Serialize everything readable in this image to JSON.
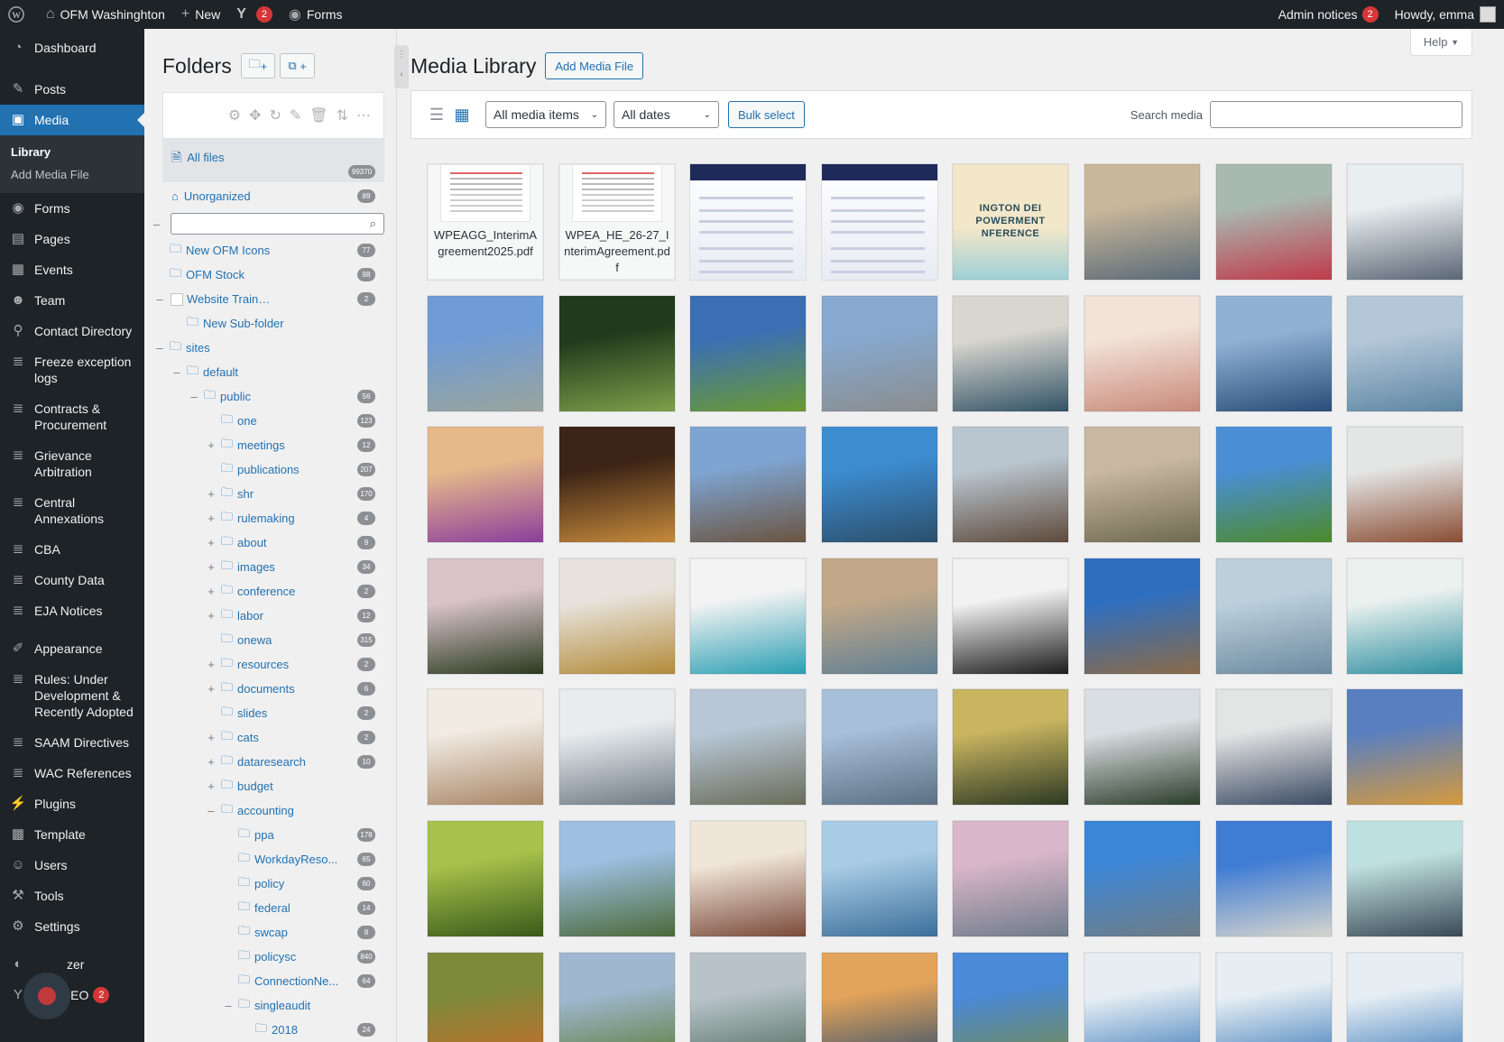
{
  "adminbar": {
    "site_name": "OFM Washinghton",
    "new_label": "New",
    "yoast_count": "2",
    "forms_label": "Forms",
    "admin_notices_label": "Admin notices",
    "admin_notices_count": "2",
    "howdy": "Howdy, emma"
  },
  "menu": {
    "dashboard": "Dashboard",
    "posts": "Posts",
    "media": "Media",
    "media_sub": {
      "library": "Library",
      "add": "Add Media File"
    },
    "forms": "Forms",
    "pages": "Pages",
    "events": "Events",
    "team": "Team",
    "contact": "Contact Directory",
    "freeze": "Freeze exception logs",
    "contracts": "Contracts & Procurement",
    "grievance": "Grievance Arbitration",
    "central": "Central Annexations",
    "cba": "CBA",
    "county": "County Data",
    "eja": "EJA Notices",
    "appearance": "Appearance",
    "rules": "Rules: Under Development & Recently Adopted",
    "saam": "SAAM Directives",
    "wac": "WAC References",
    "plugins": "Plugins",
    "template": "Template",
    "users": "Users",
    "tools": "Tools",
    "settings": "Settings",
    "item_partial_1": "zer",
    "item_partial_2": "st SEO",
    "seo_count": "2"
  },
  "folders": {
    "title": "Folders",
    "new_folder_btn": "+",
    "new_sub_btn": "+",
    "all_files": "All files",
    "all_files_count": "99370",
    "unorganized": "Unorganized",
    "unorganized_count": "89",
    "tree": [
      {
        "label": "New OFM Icons",
        "count": "77",
        "depth": 0,
        "toggle": ""
      },
      {
        "label": "OFM Stock",
        "count": "98",
        "depth": 0,
        "toggle": ""
      },
      {
        "label": "Website Training",
        "count": "2",
        "depth": 0,
        "toggle": "–",
        "checkbox": true
      },
      {
        "label": "New Sub-folder",
        "count": "",
        "depth": 1,
        "toggle": ""
      },
      {
        "label": "sites",
        "count": "",
        "depth": 0,
        "toggle": "–"
      },
      {
        "label": "default",
        "count": "",
        "depth": 1,
        "toggle": "–"
      },
      {
        "label": "public",
        "count": "56",
        "depth": 2,
        "toggle": "–"
      },
      {
        "label": "one",
        "count": "123",
        "depth": 3,
        "toggle": ""
      },
      {
        "label": "meetings",
        "count": "12",
        "depth": 3,
        "toggle": "+"
      },
      {
        "label": "publications",
        "count": "207",
        "depth": 3,
        "toggle": ""
      },
      {
        "label": "shr",
        "count": "170",
        "depth": 3,
        "toggle": "+"
      },
      {
        "label": "rulemaking",
        "count": "4",
        "depth": 3,
        "toggle": "+"
      },
      {
        "label": "about",
        "count": "9",
        "depth": 3,
        "toggle": "+"
      },
      {
        "label": "images",
        "count": "34",
        "depth": 3,
        "toggle": "+"
      },
      {
        "label": "conference",
        "count": "2",
        "depth": 3,
        "toggle": "+"
      },
      {
        "label": "labor",
        "count": "12",
        "depth": 3,
        "toggle": "+"
      },
      {
        "label": "onewa",
        "count": "315",
        "depth": 3,
        "toggle": ""
      },
      {
        "label": "resources",
        "count": "2",
        "depth": 3,
        "toggle": "+"
      },
      {
        "label": "documents",
        "count": "6",
        "depth": 3,
        "toggle": "+"
      },
      {
        "label": "slides",
        "count": "2",
        "depth": 3,
        "toggle": ""
      },
      {
        "label": "cats",
        "count": "2",
        "depth": 3,
        "toggle": "+"
      },
      {
        "label": "dataresearch",
        "count": "10",
        "depth": 3,
        "toggle": "+"
      },
      {
        "label": "budget",
        "count": "",
        "depth": 3,
        "toggle": "+"
      },
      {
        "label": "accounting",
        "count": "",
        "depth": 3,
        "toggle": "–"
      },
      {
        "label": "ppa",
        "count": "178",
        "depth": 4,
        "toggle": ""
      },
      {
        "label": "WorkdayReso...",
        "count": "65",
        "depth": 4,
        "toggle": ""
      },
      {
        "label": "policy",
        "count": "60",
        "depth": 4,
        "toggle": ""
      },
      {
        "label": "federal",
        "count": "14",
        "depth": 4,
        "toggle": ""
      },
      {
        "label": "swcap",
        "count": "8",
        "depth": 4,
        "toggle": ""
      },
      {
        "label": "policysc",
        "count": "840",
        "depth": 4,
        "toggle": ""
      },
      {
        "label": "ConnectionNe...",
        "count": "64",
        "depth": 4,
        "toggle": ""
      },
      {
        "label": "singleaudit",
        "count": "",
        "depth": 4,
        "toggle": "–"
      },
      {
        "label": "2018",
        "count": "24",
        "depth": 5,
        "toggle": ""
      }
    ]
  },
  "main": {
    "title": "Media Library",
    "add_button": "Add Media File",
    "help": "Help",
    "filter_type": "All media items",
    "filter_date": "All dates",
    "bulk_select": "Bulk select",
    "search_label": "Search media",
    "search_value": ""
  },
  "media": [
    {
      "kind": "doc",
      "name": "WPEAGG_InterimAgreement2025.pdf"
    },
    {
      "kind": "doc",
      "name": "WPEA_HE_26-27_InterimAgreement.pdf"
    },
    {
      "kind": "shot",
      "colors": [
        "#ffffff",
        "#e8ebf3"
      ]
    },
    {
      "kind": "shot",
      "colors": [
        "#ffffff",
        "#e8ebf3"
      ]
    },
    {
      "kind": "banner",
      "text": "INGTON DEI\nPOWERMENT\nNFERENCE",
      "colors": [
        "#f3e7c9",
        "#9fd0d6"
      ]
    },
    {
      "kind": "photo",
      "colors": [
        "#c9b79a",
        "#5a6b78"
      ]
    },
    {
      "kind": "photo",
      "colors": [
        "#a8b9b0",
        "#c03a4a"
      ]
    },
    {
      "kind": "photo",
      "colors": [
        "#e9eef0",
        "#5b6775"
      ]
    },
    {
      "kind": "photo",
      "colors": [
        "#6f9bd6",
        "#9aa59c"
      ]
    },
    {
      "kind": "photo",
      "colors": [
        "#1f3b1c",
        "#7da04a"
      ]
    },
    {
      "kind": "photo",
      "colors": [
        "#3b6fb4",
        "#6a9a32"
      ]
    },
    {
      "kind": "photo",
      "colors": [
        "#87a9cf",
        "#8a8d8f"
      ]
    },
    {
      "kind": "photo",
      "colors": [
        "#d9d6cf",
        "#325366"
      ]
    },
    {
      "kind": "photo",
      "colors": [
        "#f2e2d8",
        "#c98a7a"
      ]
    },
    {
      "kind": "photo",
      "colors": [
        "#8fb2d4",
        "#2a4d7a"
      ]
    },
    {
      "kind": "photo",
      "colors": [
        "#b4c7d8",
        "#5d86a3"
      ]
    },
    {
      "kind": "photo",
      "colors": [
        "#e7b98a",
        "#8a3f9c"
      ]
    },
    {
      "kind": "photo",
      "colors": [
        "#3c2416",
        "#c68a3c"
      ]
    },
    {
      "kind": "photo",
      "colors": [
        "#7ea4d2",
        "#6b5440"
      ]
    },
    {
      "kind": "photo",
      "colors": [
        "#3d8cd0",
        "#2b4f6b"
      ]
    },
    {
      "kind": "photo",
      "colors": [
        "#b9c5cf",
        "#5e4a3b"
      ]
    },
    {
      "kind": "photo",
      "colors": [
        "#c8b8a2",
        "#6f6a4f"
      ]
    },
    {
      "kind": "photo",
      "colors": [
        "#4a8fd6",
        "#4c8a2a"
      ]
    },
    {
      "kind": "photo",
      "colors": [
        "#e4e6e6",
        "#8a4d33"
      ]
    },
    {
      "kind": "photo",
      "colors": [
        "#d8c3c8",
        "#2a3a1f"
      ]
    },
    {
      "kind": "photo",
      "colors": [
        "#e7e3dc",
        "#b38b3a"
      ]
    },
    {
      "kind": "photo",
      "colors": [
        "#f3f3f3",
        "#2b9fb3"
      ]
    },
    {
      "kind": "photo",
      "colors": [
        "#c2a888",
        "#5f7f93"
      ]
    },
    {
      "kind": "photo",
      "colors": [
        "#f2f2f2",
        "#1b1b1b"
      ]
    },
    {
      "kind": "photo",
      "colors": [
        "#2f6fc0",
        "#8a6a48"
      ]
    },
    {
      "kind": "photo",
      "colors": [
        "#bcd0dc",
        "#6c8aa0"
      ]
    },
    {
      "kind": "photo",
      "colors": [
        "#eaf1ee",
        "#2f8fa0"
      ]
    },
    {
      "kind": "photo",
      "colors": [
        "#f1ebe3",
        "#a98766"
      ]
    },
    {
      "kind": "photo",
      "colors": [
        "#e8ecef",
        "#6e7a84"
      ]
    },
    {
      "kind": "photo",
      "colors": [
        "#b7c7d6",
        "#6a6d5a"
      ]
    },
    {
      "kind": "photo",
      "colors": [
        "#a7bfd9",
        "#5c7083"
      ]
    },
    {
      "kind": "photo",
      "colors": [
        "#c9b560",
        "#2e3a24"
      ]
    },
    {
      "kind": "photo",
      "colors": [
        "#d8dee2",
        "#2c3d2a"
      ]
    },
    {
      "kind": "photo",
      "colors": [
        "#e3e4e4",
        "#3b4b63"
      ]
    },
    {
      "kind": "photo",
      "colors": [
        "#5a7fc0",
        "#d49a3e"
      ]
    },
    {
      "kind": "photo",
      "colors": [
        "#a7c24a",
        "#3a5a1a"
      ]
    },
    {
      "kind": "photo",
      "colors": [
        "#9dbfe0",
        "#4b6a3a"
      ]
    },
    {
      "kind": "photo",
      "colors": [
        "#f0e6d8",
        "#7a4a3a"
      ]
    },
    {
      "kind": "photo",
      "colors": [
        "#a9cce6",
        "#3b6f9a"
      ]
    },
    {
      "kind": "photo",
      "colors": [
        "#d9b6c9",
        "#6f7c8a"
      ]
    },
    {
      "kind": "photo",
      "colors": [
        "#3d86d6",
        "#6e7d86"
      ]
    },
    {
      "kind": "photo",
      "colors": [
        "#3f7cd4",
        "#d7d5ce"
      ]
    },
    {
      "kind": "photo",
      "colors": [
        "#bfe0e0",
        "#3a4a55"
      ]
    },
    {
      "kind": "photo",
      "colors": [
        "#7d8a3a",
        "#c96a2a"
      ]
    },
    {
      "kind": "photo",
      "colors": [
        "#9fb8d0",
        "#5a7a32"
      ]
    },
    {
      "kind": "photo",
      "colors": [
        "#b8c3c9",
        "#4d6a5a"
      ]
    },
    {
      "kind": "photo",
      "colors": [
        "#e2a35a",
        "#2d4c6e"
      ]
    },
    {
      "kind": "photo",
      "colors": [
        "#4a8ad6",
        "#7a8c4a"
      ]
    },
    {
      "kind": "photo",
      "colors": [
        "#e6eef4",
        "#3a79b8"
      ]
    },
    {
      "kind": "photo",
      "colors": [
        "#e6eef4",
        "#3a79b8"
      ]
    },
    {
      "kind": "photo",
      "colors": [
        "#e6eef4",
        "#3a79b8"
      ]
    }
  ]
}
